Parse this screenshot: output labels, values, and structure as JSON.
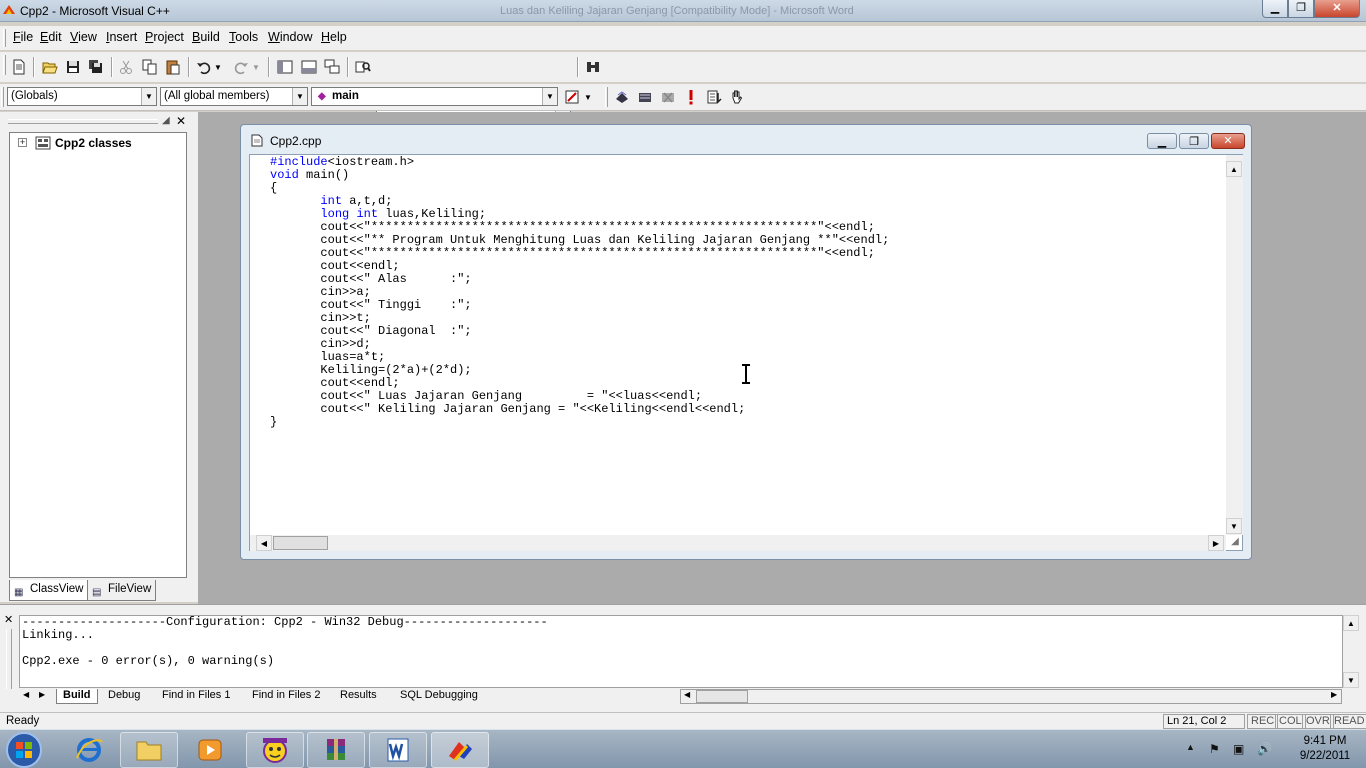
{
  "window": {
    "title": "Cpp2 - Microsoft Visual C++",
    "background_title": "Luas dan Keliling Jajaran Genjang [Compatibility Mode] - Microsoft Word"
  },
  "menu": [
    "File",
    "Edit",
    "View",
    "Insert",
    "Project",
    "Build",
    "Tools",
    "Window",
    "Help"
  ],
  "menu_underline": [
    "F",
    "E",
    "V",
    "I",
    "P",
    "B",
    "T",
    "W",
    "H"
  ],
  "toolbar": {
    "find_combo_value": ""
  },
  "wizardbar": {
    "scope": "(Globals)",
    "members": "(All global members)",
    "function": "main"
  },
  "classview": {
    "root": "Cpp2 classes",
    "tabs": [
      "ClassView",
      "FileView"
    ]
  },
  "document": {
    "title": "Cpp2.cpp",
    "lines": [
      "#include<iostream.h>",
      "void main()",
      "{",
      "       int a,t,d;",
      "       long int luas,Keliling;",
      "       cout<<\"**************************************************************\"<<endl;",
      "       cout<<\"** Program Untuk Menghitung Luas dan Keliling Jajaran Genjang **\"<<endl;",
      "       cout<<\"**************************************************************\"<<endl;",
      "       cout<<endl;",
      "       cout<<\" Alas      :\";",
      "       cin>>a;",
      "       cout<<\" Tinggi    :\";",
      "       cin>>t;",
      "       cout<<\" Diagonal  :\";",
      "       cin>>d;",
      "       luas=a*t;",
      "       Keliling=(2*a)+(2*d);",
      "       cout<<endl;",
      "       cout<<\" Luas Jajaran Genjang         = \"<<luas<<endl;",
      "       cout<<\" Keliling Jajaran Genjang = \"<<Keliling<<endl<<endl;",
      "}"
    ]
  },
  "output": {
    "lines": [
      "--------------------Configuration: Cpp2 - Win32 Debug--------------------",
      "Linking...",
      "",
      "Cpp2.exe - 0 error(s), 0 warning(s)"
    ],
    "tabs": [
      "Build",
      "Debug",
      "Find in Files 1",
      "Find in Files 2",
      "Results",
      "SQL Debugging"
    ]
  },
  "status": {
    "text": "Ready",
    "position": "Ln 21, Col 2",
    "indicators": [
      "REC",
      "COL",
      "OVR",
      "READ"
    ]
  },
  "clock": {
    "time": "9:41 PM",
    "date": "9/22/2011"
  },
  "colors": {
    "keyword": "#0000ff",
    "mdi_bg": "#ababab",
    "chrome": "#f0f0f0"
  }
}
